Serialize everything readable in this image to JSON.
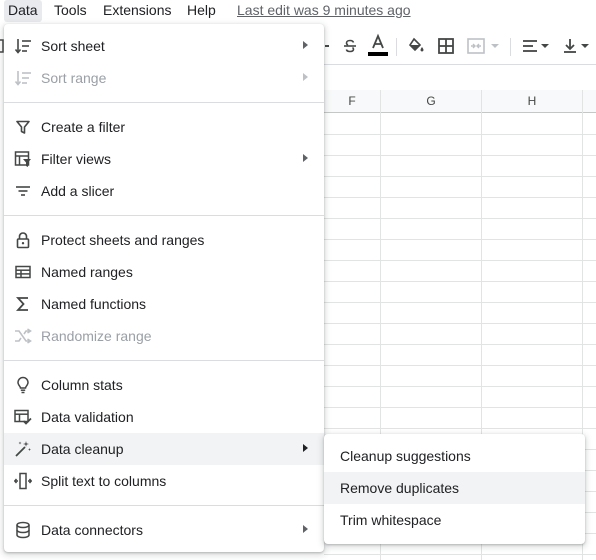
{
  "menubar": {
    "items": [
      "Data",
      "Tools",
      "Extensions",
      "Help"
    ],
    "last_edit": "Last edit was 9 minutes ago"
  },
  "toolbar": {
    "icons": [
      "strikethrough-icon",
      "text-color-icon",
      "fill-color-icon",
      "borders-icon",
      "merge-cells-icon",
      "horizontal-align-icon",
      "vertical-align-icon"
    ],
    "text_color_underline": "#000000"
  },
  "grid": {
    "columns": [
      "F",
      "G",
      "H"
    ]
  },
  "data_menu": {
    "items": [
      {
        "label": "Sort sheet",
        "icon": "sort-icon",
        "submenu": true,
        "disabled": false
      },
      {
        "label": "Sort range",
        "icon": "sort-icon",
        "submenu": true,
        "disabled": true
      },
      {
        "label": "Create a filter",
        "icon": "filter-icon",
        "submenu": false,
        "disabled": false
      },
      {
        "label": "Filter views",
        "icon": "filter-views-icon",
        "submenu": true,
        "disabled": false
      },
      {
        "label": "Add a slicer",
        "icon": "slicer-icon",
        "submenu": false,
        "disabled": false
      },
      {
        "label": "Protect sheets and ranges",
        "icon": "lock-icon",
        "submenu": false,
        "disabled": false
      },
      {
        "label": "Named ranges",
        "icon": "table-icon",
        "submenu": false,
        "disabled": false
      },
      {
        "label": "Named functions",
        "icon": "sigma-icon",
        "submenu": false,
        "disabled": false
      },
      {
        "label": "Randomize range",
        "icon": "shuffle-icon",
        "submenu": false,
        "disabled": true
      },
      {
        "label": "Column stats",
        "icon": "lightbulb-icon",
        "submenu": false,
        "disabled": false
      },
      {
        "label": "Data validation",
        "icon": "data-validation-icon",
        "submenu": false,
        "disabled": false
      },
      {
        "label": "Data cleanup",
        "icon": "magic-wand-icon",
        "submenu": true,
        "disabled": false,
        "highlighted": true
      },
      {
        "label": "Split text to columns",
        "icon": "split-columns-icon",
        "submenu": false,
        "disabled": false
      },
      {
        "label": "Data connectors",
        "icon": "database-icon",
        "submenu": true,
        "disabled": false
      }
    ]
  },
  "cleanup_submenu": {
    "items": [
      {
        "label": "Cleanup suggestions"
      },
      {
        "label": "Remove duplicates",
        "highlighted": true
      },
      {
        "label": "Trim whitespace"
      }
    ]
  }
}
